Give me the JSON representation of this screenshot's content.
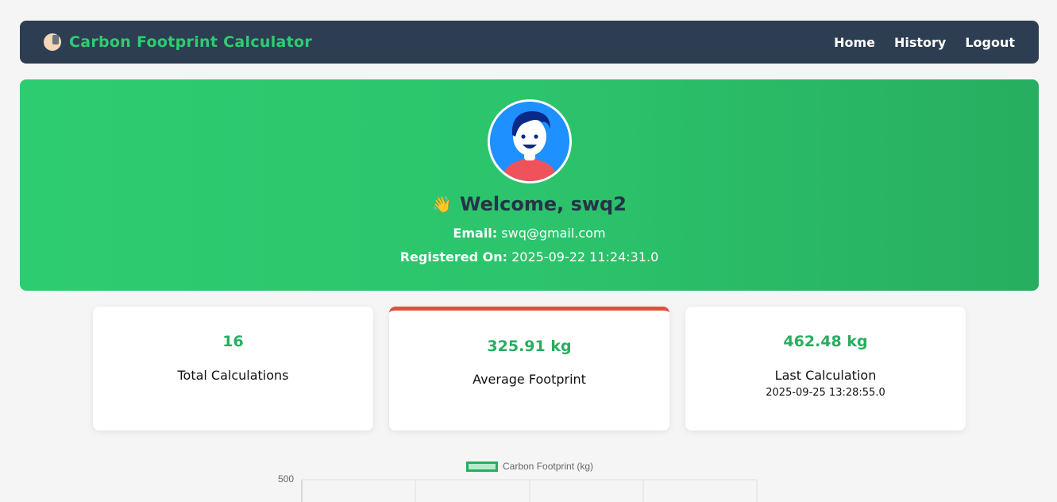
{
  "nav": {
    "title": "Carbon Footprint Calculator",
    "links": [
      "Home",
      "History",
      "Logout"
    ]
  },
  "hero": {
    "welcome": "Welcome, swq2",
    "email_label": "Email:",
    "email": "swq@gmail.com",
    "registered_label": "Registered On:",
    "registered": "2025-09-22 11:24:31.0"
  },
  "stats": [
    {
      "value": "16",
      "label": "Total Calculations"
    },
    {
      "value": "325.91 kg",
      "label": "Average Footprint"
    },
    {
      "value": "462.48 kg",
      "label": "Last Calculation",
      "sub": "2025-09-25 13:28:55.0"
    }
  ],
  "colors": {
    "navbar": "#2e3e52",
    "brand": "#2ecc71",
    "hero_start": "#2ecc71",
    "hero_end": "#27ae60",
    "stat_value": "#27ae60",
    "highlight_border": "#e74c3c"
  },
  "chart_data": {
    "type": "line",
    "legend": [
      "Carbon Footprint (kg)"
    ],
    "series": [
      {
        "name": "Carbon Footprint (kg)",
        "values": []
      }
    ],
    "y_ticks": [
      "500"
    ],
    "legend_position": "top",
    "grid": true
  }
}
